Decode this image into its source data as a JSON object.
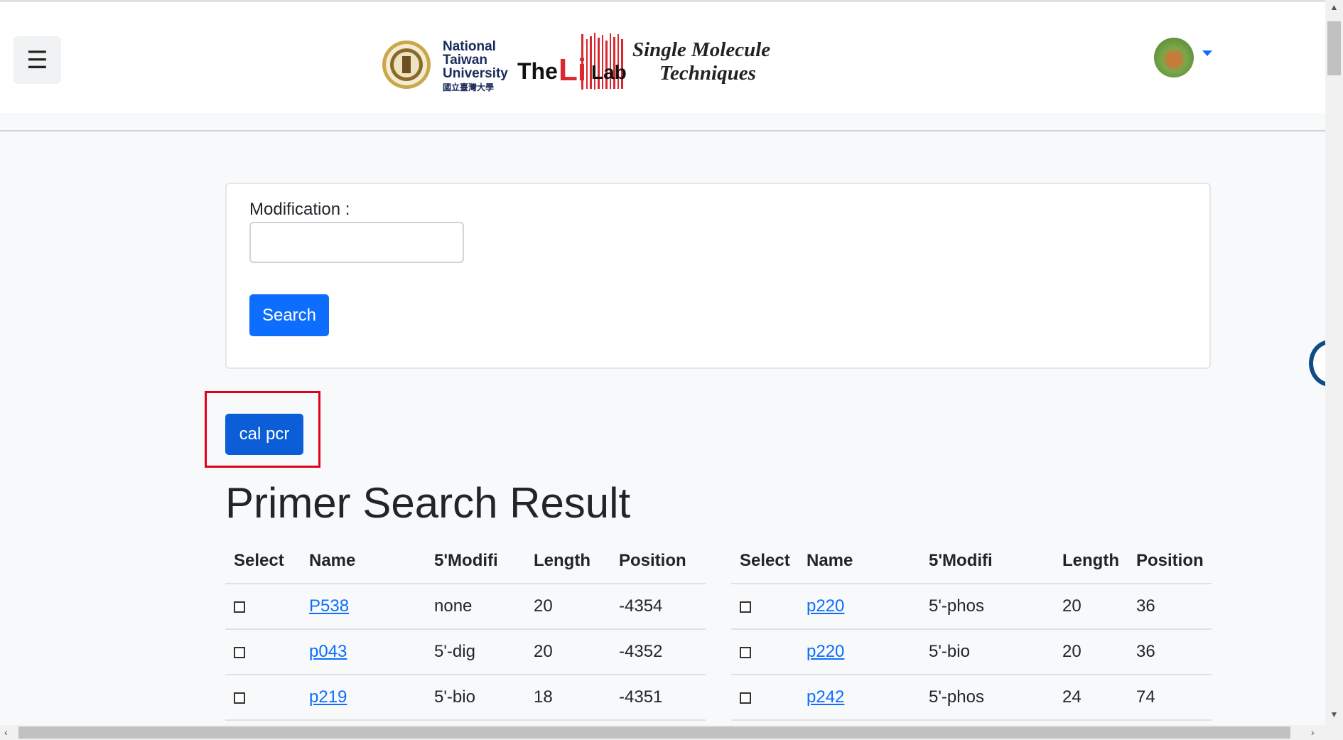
{
  "navbar": {
    "toggler_icon": "hamburger-icon",
    "logo": {
      "university_en": [
        "National",
        "Taiwan",
        "University"
      ],
      "university_zh": "國立臺灣大學",
      "lab_prefix": "The",
      "lab_li": "Li",
      "lab_suffix": "Lab",
      "tagline": [
        "Single Molecule",
        "Techniques"
      ]
    },
    "avatar_icon": "user-avatar",
    "dropdown_icon": "caret-down-icon",
    "accent_color": "#0d6efd"
  },
  "search_form": {
    "label": "Modification :",
    "value": "",
    "placeholder": "",
    "search_button": "Search"
  },
  "actions": {
    "cal_pcr_button": "cal pcr"
  },
  "results": {
    "title": "Primer Search Result",
    "columns": [
      "Select",
      "Name",
      "5'Modifi",
      "Length",
      "Position"
    ],
    "left_rows": [
      {
        "name": "P538",
        "modifi": "none",
        "length": "20",
        "position": "-4354"
      },
      {
        "name": "p043",
        "modifi": "5'-dig",
        "length": "20",
        "position": "-4352"
      },
      {
        "name": "p219",
        "modifi": "5'-bio",
        "length": "18",
        "position": "-4351"
      }
    ],
    "right_rows": [
      {
        "name": "p220",
        "modifi": "5'-phos",
        "length": "20",
        "position": "36"
      },
      {
        "name": "p220",
        "modifi": "5'-bio",
        "length": "20",
        "position": "36"
      },
      {
        "name": "p242",
        "modifi": "5'-phos",
        "length": "24",
        "position": "74"
      }
    ]
  }
}
